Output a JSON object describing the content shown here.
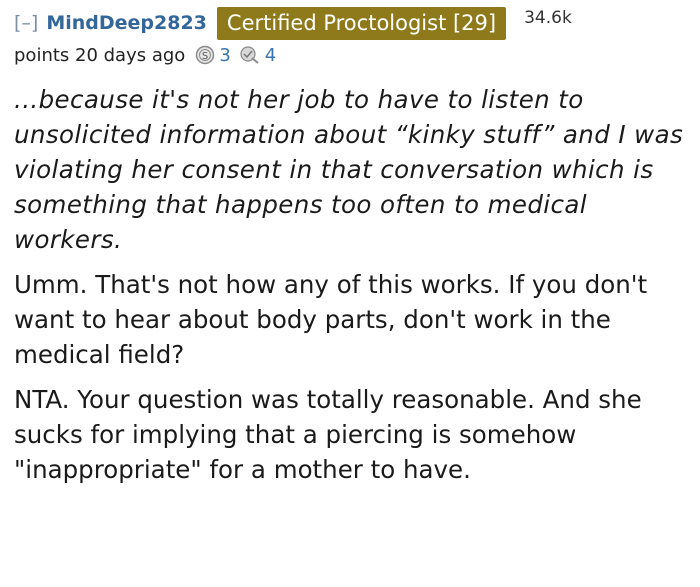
{
  "comment": {
    "collapse_label": "[–]",
    "author": "MindDeep2823",
    "flair": "Certified Proctologist [29]",
    "score": "34.6k",
    "meta_time": "points 20 days ago",
    "awards": [
      {
        "icon": "silver-award-icon",
        "count": "3"
      },
      {
        "icon": "helpful-award-icon",
        "count": "4"
      }
    ],
    "quote": "...because it's not her job to have to listen to unsolicited information about “kinky stuff” and I was violating her consent in that conversation which is something that happens too often to medical workers.",
    "paragraph_1": "Umm. That's not how any of this works. If you don't want to hear about body parts, don't work in the medical field?",
    "paragraph_2": "NTA. Your question was totally reasonable. And she sucks for implying that a piercing is somehow \"inappropriate\" for a mother to have.",
    "colors": {
      "author": "#336699",
      "flair_bg": "#8e7a1a",
      "flair_text": "#ffffff",
      "collapse": "#7a8ea6",
      "award_count": "#3a74b0"
    }
  }
}
